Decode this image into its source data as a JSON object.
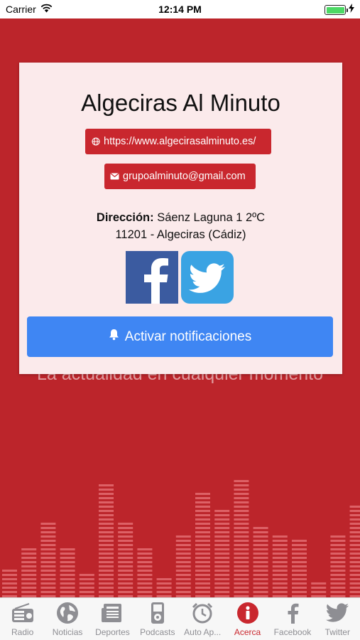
{
  "status_bar": {
    "carrier": "Carrier",
    "time": "12:14 PM",
    "battery_level": 1.0
  },
  "card": {
    "title": "Algeciras Al Minuto",
    "website": "https://www.algecirasalminuto.es/",
    "email": "grupoalminuto@gmail.com",
    "address_label": "Dirección:",
    "address_line1": "Sáenz Laguna 1 2ºC",
    "address_line2": "11201 - Algeciras (Cádiz)",
    "notify_button": "Activar notificaciones"
  },
  "background": {
    "tagline": "La actualidad en cualquier momento"
  },
  "tabs": [
    {
      "label": "Radio",
      "icon": "radio-icon"
    },
    {
      "label": "Noticias",
      "icon": "globe-icon"
    },
    {
      "label": "Deportes",
      "icon": "newspaper-icon"
    },
    {
      "label": "Podcasts",
      "icon": "ipod-icon"
    },
    {
      "label": "Auto Ap...",
      "icon": "alarm-clock-icon"
    },
    {
      "label": "Acerca",
      "icon": "info-icon"
    },
    {
      "label": "Facebook",
      "icon": "facebook-icon"
    },
    {
      "label": "Twitter",
      "icon": "twitter-icon"
    }
  ],
  "colors": {
    "brand_red": "#bc252b",
    "pill_red": "#c9272e",
    "button_blue": "#3f86f3",
    "tab_active": "#c9272e",
    "tab_inactive": "#8e8e93"
  }
}
